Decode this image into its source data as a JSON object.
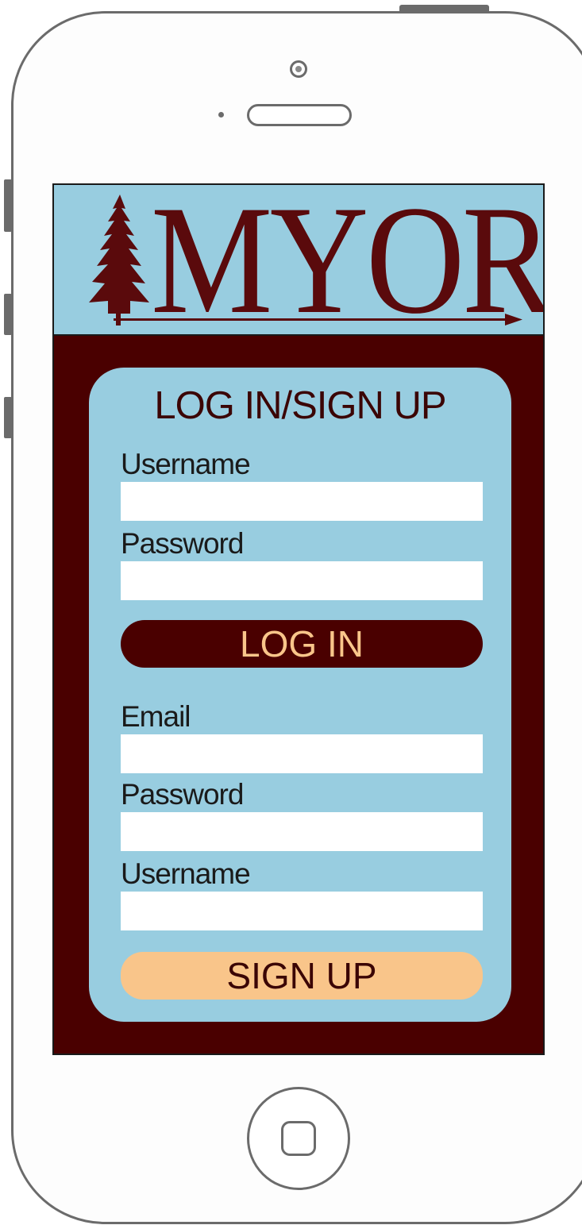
{
  "app": {
    "logo_text": "MYOR",
    "brand_color": "#4a0000",
    "accent_color": "#98cde0",
    "button_accent_color": "#f9c58a"
  },
  "card": {
    "title": "LOG IN/SIGN UP",
    "login": {
      "username_label": "Username",
      "password_label": "Password",
      "button_label": "LOG IN"
    },
    "signup": {
      "email_label": "Email",
      "password_label": "Password",
      "username_label": "Username",
      "button_label": "SIGN UP"
    }
  },
  "device": {
    "icons": [
      "camera-icon",
      "speaker-icon",
      "home-button-icon",
      "tree-logo-icon",
      "arrow-icon"
    ]
  }
}
